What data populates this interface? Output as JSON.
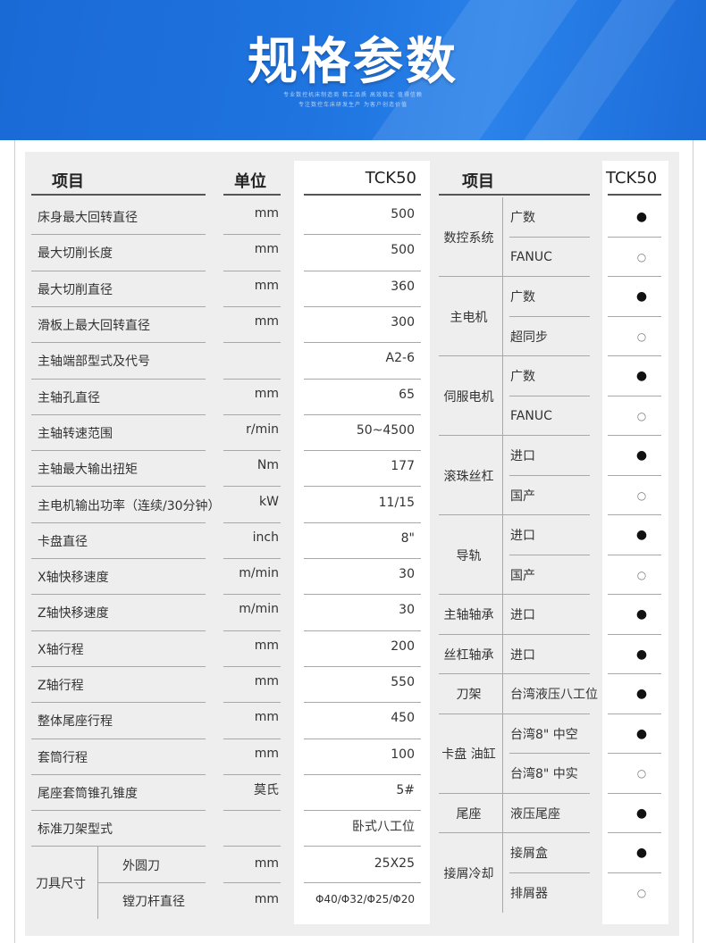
{
  "banner": {
    "title": "规格参数",
    "subtitle_1": "专业数控机床制造商 精工品质 高效稳定 值得信赖",
    "subtitle_2": "专注数控车床研发生产 为客户创造价值"
  },
  "left_table": {
    "headers": {
      "item": "项目",
      "unit": "单位",
      "model": "TCK50"
    },
    "rows": [
      {
        "item": "床身最大回转直径",
        "unit": "mm",
        "value": "500"
      },
      {
        "item": "最大切削长度",
        "unit": "mm",
        "value": "500"
      },
      {
        "item": "最大切削直径",
        "unit": "mm",
        "value": "360"
      },
      {
        "item": "滑板上最大回转直径",
        "unit": "mm",
        "value": "300"
      },
      {
        "item": "主轴端部型式及代号",
        "unit": "",
        "value": "A2-6"
      },
      {
        "item": "主轴孔直径",
        "unit": "mm",
        "value": "65"
      },
      {
        "item": "主轴转速范围",
        "unit": "r/min",
        "value": "50~4500"
      },
      {
        "item": "主轴最大输出扭矩",
        "unit": "Nm",
        "value": "177"
      },
      {
        "item": "主电机输出功率（连续/30分钟）",
        "unit": "kW",
        "value": "11/15"
      },
      {
        "item": "卡盘直径",
        "unit": "inch",
        "value": "8\""
      },
      {
        "item": "X轴快移速度",
        "unit": "m/min",
        "value": "30"
      },
      {
        "item": "Z轴快移速度",
        "unit": "m/min",
        "value": "30"
      },
      {
        "item": "X轴行程",
        "unit": "mm",
        "value": "200"
      },
      {
        "item": "Z轴行程",
        "unit": "mm",
        "value": "550"
      },
      {
        "item": "整体尾座行程",
        "unit": "mm",
        "value": "450"
      },
      {
        "item": "套筒行程",
        "unit": "mm",
        "value": "100"
      },
      {
        "item": "尾座套筒锥孔锥度",
        "unit": "莫氏",
        "value": "5#"
      },
      {
        "item": "标准刀架型式",
        "unit": "",
        "value": "卧式八工位"
      }
    ],
    "tool_size": {
      "label": "刀具尺寸",
      "sub": [
        {
          "item": "外圆刀",
          "unit": "mm",
          "value": "25X25"
        },
        {
          "item": "镗刀杆直径",
          "unit": "mm",
          "value": "Φ40/Φ32/Φ25/Φ20"
        }
      ]
    }
  },
  "right_table": {
    "headers": {
      "item": "项目",
      "model": "TCK50"
    },
    "groups": [
      {
        "name": "数控系统",
        "options": [
          {
            "label": "广数",
            "mark": "●"
          },
          {
            "label": "FANUC",
            "mark": "○"
          }
        ]
      },
      {
        "name": "主电机",
        "options": [
          {
            "label": "广数",
            "mark": "●"
          },
          {
            "label": "超同步",
            "mark": "○"
          }
        ]
      },
      {
        "name": "伺服电机",
        "options": [
          {
            "label": "广数",
            "mark": "●"
          },
          {
            "label": "FANUC",
            "mark": "○"
          }
        ]
      },
      {
        "name": "滚珠丝杠",
        "options": [
          {
            "label": "进口",
            "mark": "●"
          },
          {
            "label": "国产",
            "mark": "○"
          }
        ]
      },
      {
        "name": "导轨",
        "options": [
          {
            "label": "进口",
            "mark": "●"
          },
          {
            "label": "国产",
            "mark": "○"
          }
        ]
      },
      {
        "name": "主轴轴承",
        "options": [
          {
            "label": "进口",
            "mark": "●"
          }
        ]
      },
      {
        "name": "丝杠轴承",
        "options": [
          {
            "label": "进口",
            "mark": "●"
          }
        ]
      },
      {
        "name": "刀架",
        "options": [
          {
            "label": "台湾液压八工位",
            "mark": "●"
          }
        ]
      },
      {
        "name": "卡盘 油缸",
        "options": [
          {
            "label": "台湾8\" 中空",
            "mark": "●"
          },
          {
            "label": "台湾8\" 中实",
            "mark": "○"
          }
        ]
      },
      {
        "name": "尾座",
        "options": [
          {
            "label": "液压尾座",
            "mark": "●"
          }
        ]
      },
      {
        "name": "接屑冷却",
        "options": [
          {
            "label": "接屑盒",
            "mark": "●"
          },
          {
            "label": "排屑器",
            "mark": "○"
          }
        ]
      }
    ]
  },
  "colors": {
    "banner": "#1f74e0",
    "panel": "#eeeeee",
    "text": "#333333"
  }
}
